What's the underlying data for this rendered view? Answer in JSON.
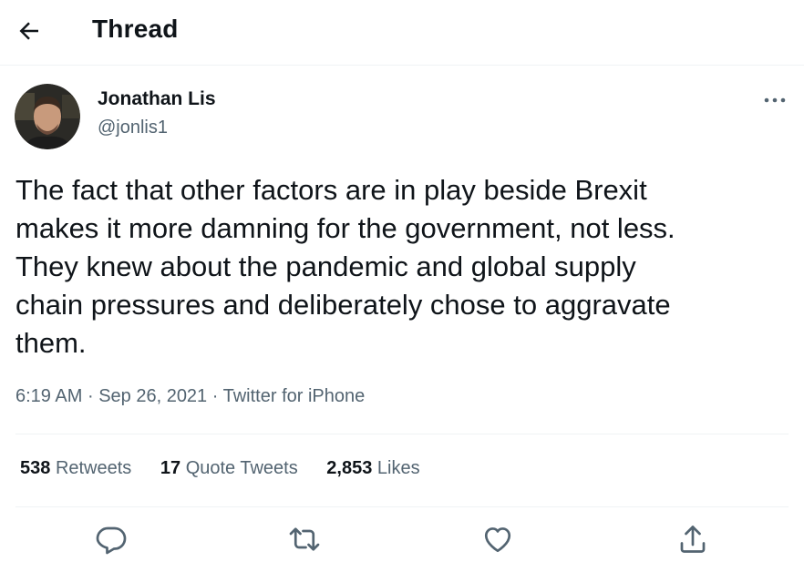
{
  "header": {
    "title": "Thread",
    "back_icon": "arrow-left-icon"
  },
  "tweet": {
    "author": {
      "name": "Jonathan Lis",
      "handle": "@jonlis1"
    },
    "text_lines": [
      "The fact that other factors are in play beside Brexit",
      "makes it more damning for the government, not less.",
      "They knew about the pandemic and global supply",
      "chain pressures and deliberately chose to aggravate",
      "them."
    ],
    "time": "6:19 AM",
    "separator": "·",
    "date": "Sep 26, 2021",
    "source": "Twitter for iPhone",
    "stats": {
      "retweets_count": "538",
      "retweets_label": "Retweets",
      "quote_count": "17",
      "quote_label": "Quote Tweets",
      "likes_count": "2,853",
      "likes_label": "Likes"
    },
    "actions": [
      "reply-icon",
      "retweet-icon",
      "like-icon",
      "share-icon"
    ]
  },
  "colors": {
    "text": "#0f1419",
    "secondary": "#536471",
    "divider": "#eff3f4"
  }
}
